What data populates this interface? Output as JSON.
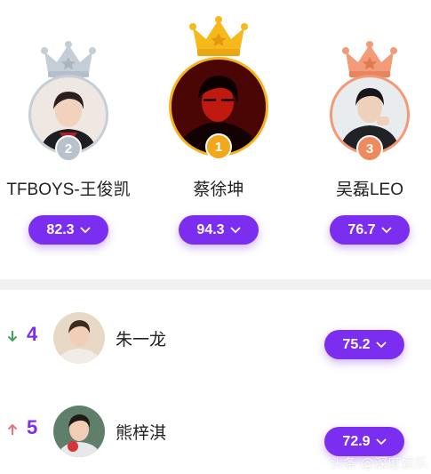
{
  "podium": [
    {
      "rank": "1",
      "name": "蔡徐坤",
      "score": "94.3",
      "crown_color": "#f6b91c",
      "ring_color": "#f5b21a"
    },
    {
      "rank": "2",
      "name": "TFBOYS-王俊凯",
      "score": "82.3",
      "crown_color": "#c5ced6",
      "ring_color": "#c6ced6"
    },
    {
      "rank": "3",
      "name": "吴磊LEO",
      "score": "76.7",
      "crown_color": "#f29b78",
      "ring_color": "#f19a76"
    }
  ],
  "list": [
    {
      "rank": "4",
      "name": "朱一龙",
      "score": "75.2",
      "trend": "down",
      "trend_color": "#3fa35b"
    },
    {
      "rank": "5",
      "name": "熊梓淇",
      "score": "72.9",
      "trend": "up",
      "trend_color": "#e8717a"
    }
  ],
  "colors": {
    "accent": "#7b2ef0",
    "divider": "#f0f0f2"
  },
  "watermark": "头条 @深度娱乐"
}
